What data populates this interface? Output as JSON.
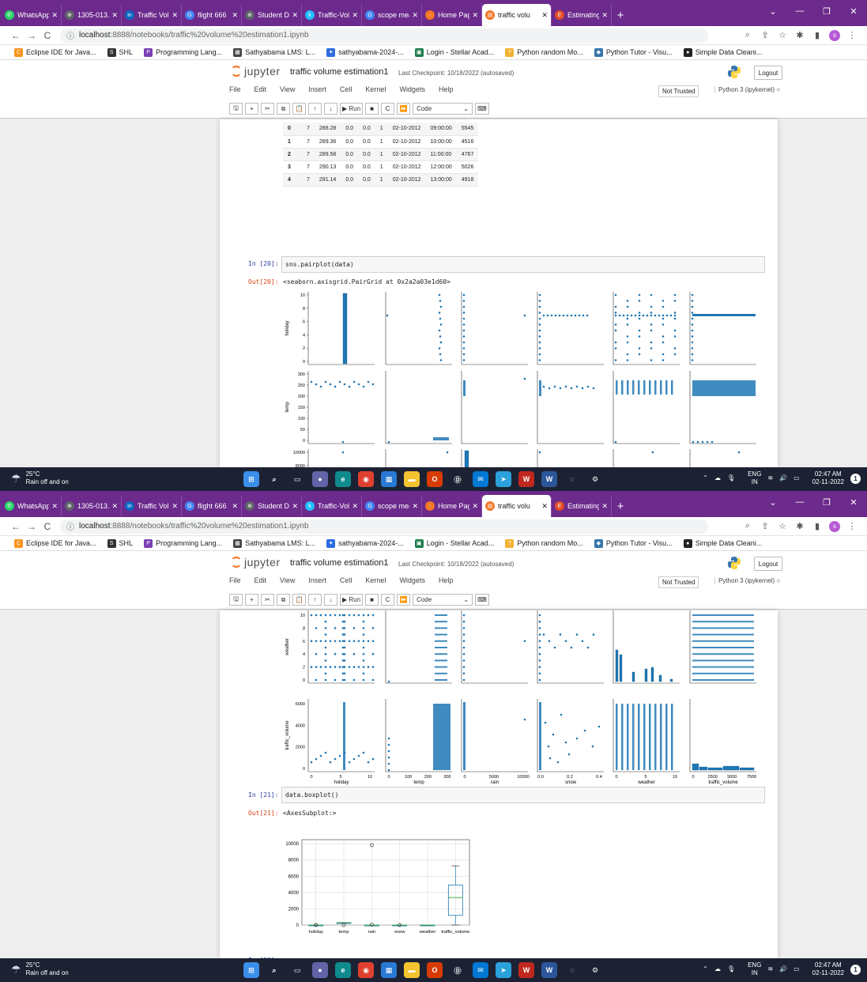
{
  "browser": {
    "tabs": [
      {
        "label": "WhatsApp",
        "icon": "whatsapp-icon",
        "color": "#25d366",
        "glyph": "✆"
      },
      {
        "label": "1305-013.p",
        "icon": "globe-icon",
        "color": "#5f6368",
        "glyph": "⊕"
      },
      {
        "label": "Traffic Volu",
        "icon": "linkedin-icon",
        "color": "#0a66c2",
        "glyph": "in"
      },
      {
        "label": "flight 666",
        "icon": "google-icon",
        "color": "#4285f4",
        "glyph": "G"
      },
      {
        "label": "Student Da",
        "icon": "globe-icon",
        "color": "#5f6368",
        "glyph": "⊕"
      },
      {
        "label": "Traffic-Volu",
        "icon": "kaggle-icon",
        "color": "#20beff",
        "glyph": "k"
      },
      {
        "label": "scope mea",
        "icon": "google-icon",
        "color": "#4285f4",
        "glyph": "G"
      },
      {
        "label": "Home Page",
        "icon": "jupyter-icon",
        "color": "#f37626",
        "glyph": "◌"
      },
      {
        "label": "traffic volu",
        "icon": "notebook-icon",
        "color": "#f37626",
        "glyph": "▤",
        "active": true
      },
      {
        "label": "Estimating",
        "icon": "e-icon",
        "color": "#e34c26",
        "glyph": "E"
      }
    ],
    "url_host": "localhost",
    "url_rest": ":8888/notebooks/traffic%20volume%20estimation1.ipynb",
    "profile_letter": "s",
    "bookmarks": [
      {
        "label": "Eclipse IDE for Java...",
        "color": "#f7941e",
        "glyph": "C"
      },
      {
        "label": "SHL",
        "color": "#333",
        "glyph": "S"
      },
      {
        "label": "Programming Lang...",
        "color": "#7b3fb5",
        "glyph": "P"
      },
      {
        "label": "Sathyabama LMS: L...",
        "color": "#444",
        "glyph": "▦"
      },
      {
        "label": "sathyabama-2024-...",
        "color": "#2d6cdf",
        "glyph": "✦"
      },
      {
        "label": "Login - Stellar Acad...",
        "color": "#1e7f4f",
        "glyph": "▣"
      },
      {
        "label": "Python random Mo...",
        "color": "#f2b233",
        "glyph": "?"
      },
      {
        "label": "Python Tutor - Visu...",
        "color": "#3776ab",
        "glyph": "◆"
      },
      {
        "label": "Simple Data Cleani...",
        "color": "#222",
        "glyph": "●"
      }
    ]
  },
  "jupyter": {
    "logo_text": "jupyter",
    "notebook_title": "traffic volume estimation1",
    "checkpoint": "Last Checkpoint: 10/18/2022  (autosaved)",
    "logout": "Logout",
    "menu": [
      "File",
      "Edit",
      "View",
      "Insert",
      "Cell",
      "Kernel",
      "Widgets",
      "Help"
    ],
    "not_trusted": "Not Trusted",
    "kernel": "Python 3 (ipykernel)",
    "run_label": "Run",
    "cell_type": "Code"
  },
  "shot1": {
    "table_rows": [
      [
        "0",
        "7",
        "288.28",
        "0.0",
        "0.0",
        "1",
        "02-10-2012",
        "09:00:00",
        "5545"
      ],
      [
        "1",
        "7",
        "289.36",
        "0.0",
        "0.0",
        "1",
        "02-10-2012",
        "10:00:00",
        "4516"
      ],
      [
        "2",
        "7",
        "289.58",
        "0.0",
        "0.0",
        "1",
        "02-10-2012",
        "11:00:00",
        "4767"
      ],
      [
        "3",
        "7",
        "290.13",
        "0.0",
        "0.0",
        "1",
        "02-10-2012",
        "12:00:00",
        "5026"
      ],
      [
        "4",
        "7",
        "291.14",
        "0.0",
        "0.0",
        "1",
        "02-10-2012",
        "13:00:00",
        "4918"
      ]
    ],
    "in_prompt": "In [20]:",
    "code": "sns.pairplot(data)",
    "out_prompt": "Out[20]:",
    "output": "<seaborn.axisgrid.PairGrid at 0x2a2a03e1d60>",
    "row_labels": [
      "holiday",
      "temp",
      "rain"
    ],
    "ticks": [
      [
        "10",
        "8",
        "6",
        "4",
        "2",
        "0"
      ],
      [
        "300",
        "250",
        "200",
        "150",
        "100",
        "50",
        "0"
      ],
      [
        "10000",
        "8000",
        "6000",
        "4000",
        "2000",
        "0"
      ]
    ]
  },
  "shot2": {
    "row_labels": [
      "weather",
      "traffic_volume"
    ],
    "ticks": [
      [
        "10",
        "8",
        "6",
        "4",
        "2",
        "0"
      ],
      [
        "6000",
        "4000",
        "2000",
        "0"
      ]
    ],
    "col_labels": [
      "holiday",
      "temp",
      "rain",
      "snow",
      "weather",
      "traffic_volume"
    ],
    "col_ticks": [
      [
        "0",
        "5",
        "10"
      ],
      [
        "0",
        "100",
        "200",
        "300"
      ],
      [
        "0",
        "5000",
        "10000"
      ],
      [
        "0.0",
        "0.2",
        "0.4"
      ],
      [
        "0",
        "5",
        "10"
      ],
      [
        "0",
        "2500",
        "5000",
        "7500"
      ]
    ],
    "in_prompt": "In [21]:",
    "code": "data.boxplot()",
    "out_prompt": "Out[21]:",
    "output": "<AxesSubplot:>",
    "next_prompt": "In [22]:"
  },
  "chart_data": [
    {
      "type": "scatter",
      "title": "",
      "kind": "pairplot",
      "variables": [
        "holiday",
        "temp",
        "rain",
        "snow",
        "weather",
        "traffic_volume"
      ],
      "diag": "hist",
      "grid": false
    },
    {
      "type": "bar",
      "kind": "boxplot",
      "categories": [
        "holiday",
        "temp",
        "rain",
        "snow",
        "weather",
        "traffic_volume"
      ],
      "ylim": [
        0,
        10500
      ],
      "yticks": [
        "10000",
        "8000",
        "6000",
        "4000",
        "2000",
        "0"
      ],
      "boxes": [
        {
          "name": "holiday",
          "q1": 7,
          "median": 7,
          "q3": 7,
          "whisker_low": 7,
          "whisker_high": 7,
          "outliers": [
            0,
            11
          ]
        },
        {
          "name": "temp",
          "q1": 272,
          "median": 282,
          "q3": 292,
          "whisker_low": 240,
          "whisker_high": 310,
          "outliers": [
            0
          ]
        },
        {
          "name": "rain",
          "q1": 0,
          "median": 0,
          "q3": 0,
          "whisker_low": 0,
          "whisker_high": 0,
          "outliers": [
            9831,
            55
          ]
        },
        {
          "name": "snow",
          "q1": 0,
          "median": 0,
          "q3": 0,
          "whisker_low": 0,
          "whisker_high": 0,
          "outliers": [
            0.5
          ]
        },
        {
          "name": "weather",
          "q1": 1,
          "median": 1,
          "q3": 6,
          "whisker_low": 0,
          "whisker_high": 11,
          "outliers": []
        },
        {
          "name": "traffic_volume",
          "q1": 1190,
          "median": 3380,
          "q3": 4930,
          "whisker_low": 0,
          "whisker_high": 7280,
          "outliers": []
        }
      ],
      "grid": true,
      "colors": {
        "box": "#1f77b4",
        "median": "#2ca02c"
      }
    }
  ],
  "taskbar": {
    "temperature": "25°C",
    "weather_desc": "Rain off and on",
    "lang1": "ENG",
    "lang2": "IN",
    "time": "02:47 AM",
    "date": "02-11-2022",
    "notifications": "1",
    "apps": [
      {
        "name": "start-icon",
        "color": "#3b8eea",
        "glyph": "⊞"
      },
      {
        "name": "search-icon",
        "color": "transparent",
        "glyph": "⌕"
      },
      {
        "name": "taskview-icon",
        "color": "transparent",
        "glyph": "▭"
      },
      {
        "name": "teams-icon",
        "color": "#6264a7",
        "glyph": "●"
      },
      {
        "name": "edge-icon",
        "color": "#0f8b8d",
        "glyph": "e"
      },
      {
        "name": "chrome-icon",
        "color": "#e0402f",
        "glyph": "◉"
      },
      {
        "name": "store-icon",
        "color": "#2a7ad5",
        "glyph": "▦"
      },
      {
        "name": "folder-icon",
        "color": "#f4c430",
        "glyph": "▬"
      },
      {
        "name": "office-icon",
        "color": "#d83b01",
        "glyph": "O"
      },
      {
        "name": "dell-icon",
        "color": "transparent",
        "glyph": "Ⓓ"
      },
      {
        "name": "mail-icon",
        "color": "#0078d4",
        "glyph": "✉"
      },
      {
        "name": "telegram-icon",
        "color": "#2aa1da",
        "glyph": "➤"
      },
      {
        "name": "wps-icon",
        "color": "#c0281e",
        "glyph": "W"
      },
      {
        "name": "word-icon",
        "color": "#2b579a",
        "glyph": "W"
      },
      {
        "name": "jupyter-task-icon",
        "color": "transparent",
        "glyph": "◌"
      },
      {
        "name": "settings-icon",
        "color": "transparent",
        "glyph": "⚙"
      }
    ]
  }
}
